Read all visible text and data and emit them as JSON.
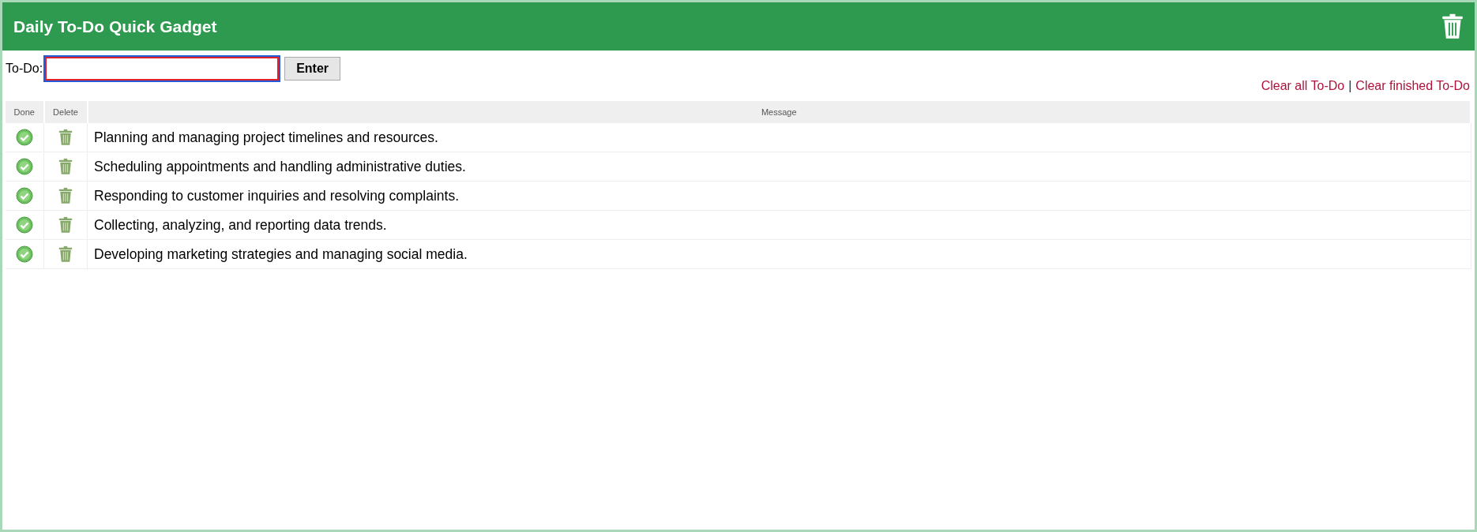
{
  "header": {
    "title": "Daily To-Do Quick Gadget"
  },
  "entry": {
    "label": "To-Do:",
    "button": "Enter"
  },
  "links": [
    {
      "label": "Clear all To-Do"
    },
    {
      "label": "Clear finished To-Do"
    }
  ],
  "links_separator": "|",
  "table": {
    "columns": [
      "Done",
      "Delete",
      "Message"
    ],
    "rows": [
      {
        "message": "Planning and managing project timelines and resources."
      },
      {
        "message": "Scheduling appointments and handling administrative duties."
      },
      {
        "message": "Responding to customer inquiries and resolving complaints."
      },
      {
        "message": "Collecting, analyzing, and reporting data trends."
      },
      {
        "message": "Developing marketing strategies and managing social media."
      }
    ]
  }
}
